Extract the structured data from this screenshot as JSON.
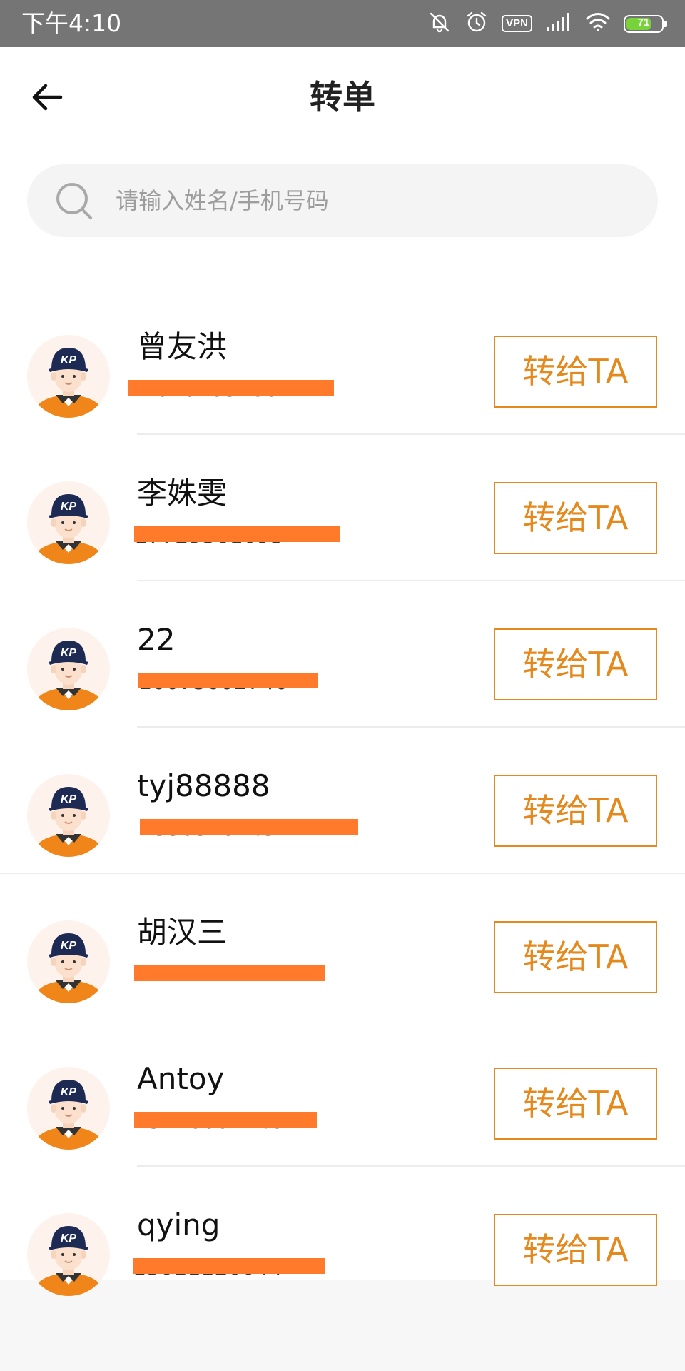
{
  "status_bar": {
    "time": "下午4:10",
    "vpn_label": "VPN",
    "battery_level": "71",
    "icons": [
      "mute-icon",
      "alarm-icon",
      "vpn-icon",
      "signal-icon",
      "wifi-icon",
      "battery-icon"
    ]
  },
  "header": {
    "title": "转单",
    "back_icon": "arrow-left-icon"
  },
  "search": {
    "placeholder": "请输入姓名/手机号码",
    "value": "",
    "icon": "search-icon"
  },
  "colors": {
    "accent": "#e4891e",
    "redaction": "#ff7a2b",
    "status_bar": "#757575",
    "avatar_bg": "#fdf3ec"
  },
  "button_label": "转给TA",
  "contacts": [
    {
      "name": "曾友洪",
      "phone": "17020705100"
    },
    {
      "name": "李姝雯",
      "phone": "17729361093"
    },
    {
      "name": "22",
      "phone": "10075002740"
    },
    {
      "name": "tyj88888",
      "phone": "13303782437"
    },
    {
      "name": "胡汉三",
      "phone": ""
    },
    {
      "name": "Antoy",
      "phone": "15120002240"
    },
    {
      "name": "qying",
      "phone": "13011120044"
    }
  ]
}
